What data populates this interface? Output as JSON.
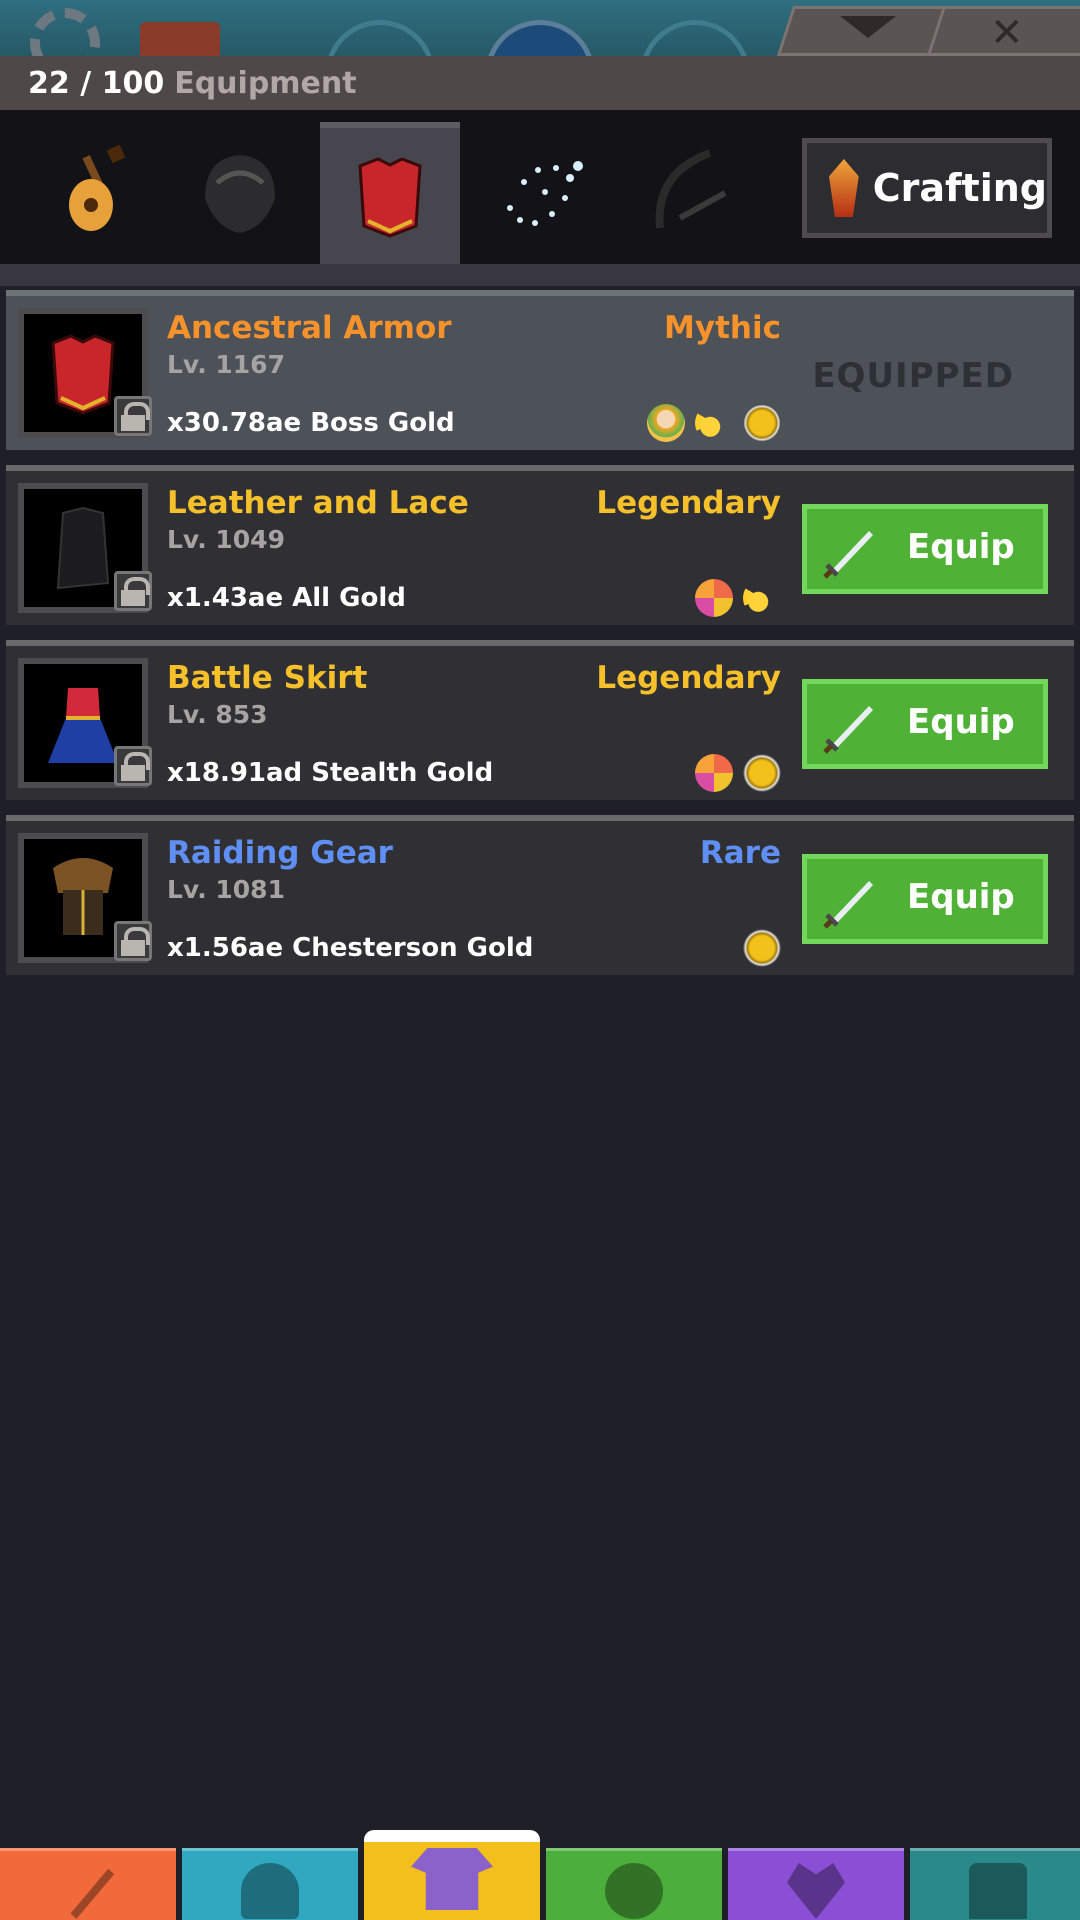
{
  "header": {
    "count": "22 / 100",
    "label": "Equipment"
  },
  "crafting": {
    "label": "Crafting"
  },
  "tabs": [
    {
      "name": "guitar-tab",
      "icon": "guitar-icon"
    },
    {
      "name": "helmet-tab",
      "icon": "hair-helmet-icon"
    },
    {
      "name": "armor-tab",
      "icon": "red-armor-icon",
      "active": true
    },
    {
      "name": "aura-tab",
      "icon": "sparkles-icon"
    },
    {
      "name": "weapon-tab",
      "icon": "scythe-icon"
    }
  ],
  "items": [
    {
      "name": "Ancestral Armor",
      "level": "Lv. 1167",
      "bonus": "x30.78ae Boss Gold",
      "rarity": "Mythic",
      "name_color": "#f5922c",
      "rarity_color": "#f5922c",
      "status": "EQUIPPED",
      "icons": [
        "hero-icon",
        "star-icon",
        "coin-icon"
      ]
    },
    {
      "name": "Leather and Lace",
      "level": "Lv. 1049",
      "bonus": "x1.43ae All Gold",
      "rarity": "Legendary",
      "name_color": "#f5c02a",
      "rarity_color": "#f5c02a",
      "button": "Equip",
      "icons": [
        "multi-coin-icon",
        "star-icon"
      ]
    },
    {
      "name": "Battle Skirt",
      "level": "Lv. 853",
      "bonus": "x18.91ad Stealth Gold",
      "rarity": "Legendary",
      "name_color": "#f5c02a",
      "rarity_color": "#f5c02a",
      "button": "Equip",
      "icons": [
        "multi-coin-icon",
        "coin-icon"
      ]
    },
    {
      "name": "Raiding Gear",
      "level": "Lv. 1081",
      "bonus": "x1.56ae Chesterson Gold",
      "rarity": "Rare",
      "name_color": "#5f8ff2",
      "rarity_color": "#5f8ff2",
      "button": "Equip",
      "icons": [
        "coin-icon"
      ]
    }
  ],
  "bottom_nav": [
    {
      "name": "sword",
      "color": "#f26a3c"
    },
    {
      "name": "heroes",
      "color": "#2fa8c0"
    },
    {
      "name": "equipment",
      "color": "#f3bf1c",
      "active": true
    },
    {
      "name": "pets",
      "color": "#4caf3c"
    },
    {
      "name": "clan",
      "color": "#8b4fd6"
    },
    {
      "name": "shop",
      "color": "#2a8a8a"
    }
  ]
}
